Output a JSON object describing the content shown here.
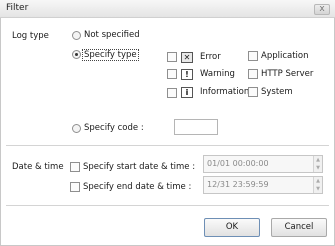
{
  "window": {
    "title": "Filter",
    "close_symbol": "x"
  },
  "log_type": {
    "label": "Log type",
    "not_specified": "Not specified",
    "specify_type": "Specify type",
    "specify_code": "Specify code :",
    "code_value": "",
    "types": {
      "error": "Error",
      "warning": "Warning",
      "information": "Information",
      "application": "Application",
      "http_server": "HTTP Server",
      "system": "System"
    }
  },
  "date_time": {
    "label": "Date & time",
    "start_label": "Specify start date & time :",
    "end_label": "Specify end date & time :",
    "start_value": "01/01 00:00:00",
    "end_value": "12/31 23:59:59"
  },
  "buttons": {
    "ok": "OK",
    "cancel": "Cancel"
  },
  "icons": {
    "error": "x-box-icon",
    "warning": "exclamation-icon",
    "information": "info-icon"
  }
}
